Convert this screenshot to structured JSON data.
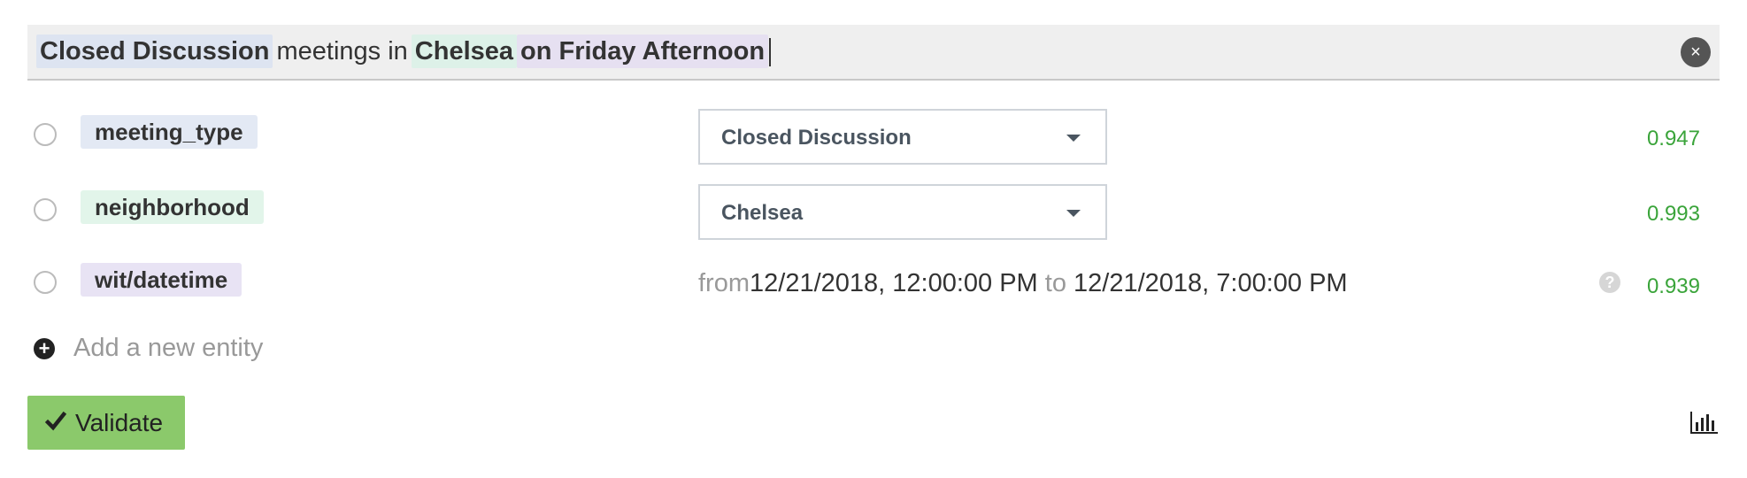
{
  "expression": {
    "parts": [
      {
        "text": "Closed Discussion",
        "kind": "meeting_type"
      },
      {
        "text": "meetings in",
        "kind": "plain"
      },
      {
        "text": "Chelsea",
        "kind": "neighborhood"
      },
      {
        "text": "on Friday Afternoon",
        "kind": "datetime"
      }
    ],
    "clear_label": "×"
  },
  "entities": [
    {
      "name": "meeting_type",
      "value": "Closed Discussion",
      "confidence": "0.947",
      "color": "#e3e9f4"
    },
    {
      "name": "neighborhood",
      "value": "Chelsea",
      "confidence": "0.993",
      "color": "#e2f5ea"
    },
    {
      "name": "wit/datetime",
      "from_label": "from",
      "from": "12/21/2018, 12:00:00 PM",
      "to_label": "to",
      "to": "12/21/2018, 7:00:00 PM",
      "help": "?",
      "confidence": "0.939",
      "color": "#e8e3f4"
    }
  ],
  "add_entity": {
    "label": "Add a new entity"
  },
  "validate": {
    "label": "Validate",
    "color": "#8bc96b"
  },
  "colors": {
    "confidence": "#3aa43a",
    "accent_dark": "#4a5560"
  }
}
